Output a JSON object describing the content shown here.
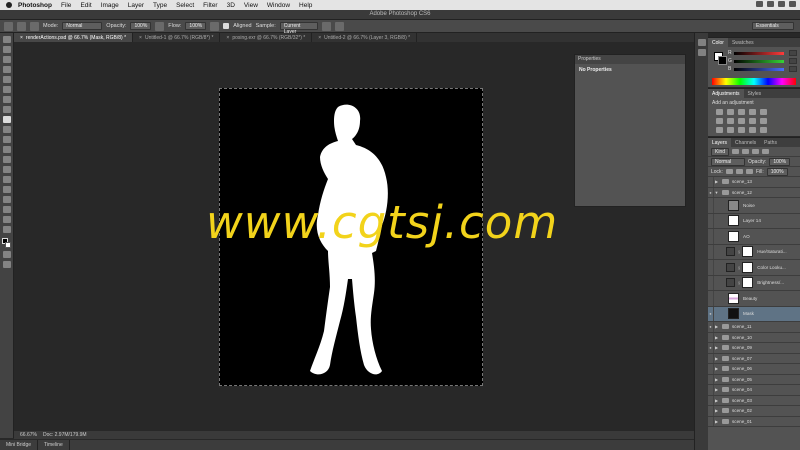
{
  "mac_menu": {
    "app": "Photoshop",
    "items": [
      "File",
      "Edit",
      "Image",
      "Layer",
      "Type",
      "Select",
      "Filter",
      "3D",
      "View",
      "Window",
      "Help"
    ]
  },
  "window_title": "Adobe Photoshop CS6",
  "options_bar": {
    "mode_label": "Mode:",
    "mode_value": "Normal",
    "opacity_label": "Opacity:",
    "opacity_value": "100%",
    "flow_label": "Flow:",
    "flow_value": "100%",
    "aligned_label": "Aligned",
    "sample_label": "Sample:",
    "sample_value": "Current Layer",
    "workspace": "Essentials"
  },
  "doc_tabs": [
    {
      "name": "renderActions.psd @ 66.7% (Mask, RGB/8) *"
    },
    {
      "name": "Untitled-1 @ 66.7% (RGB/8*) *"
    },
    {
      "name": "posing.exr @ 66.7% (RGB/32*) *"
    },
    {
      "name": "Untitled-2 @ 66.7% (Layer 3, RGB/8) *"
    }
  ],
  "watermark": "www.cgtsj.com",
  "properties_panel": {
    "title": "Properties",
    "content": "No Properties"
  },
  "status": {
    "zoom": "66.67%",
    "doc_info": "Doc: 2.97M/179.9M"
  },
  "bottom_tabs": [
    "Mini Bridge",
    "Timeline"
  ],
  "color_panel": {
    "tabs": [
      "Color",
      "Swatches"
    ],
    "channels": [
      {
        "label": "R",
        "color": "#ff3b3b"
      },
      {
        "label": "G",
        "color": "#35d435"
      },
      {
        "label": "B",
        "color": "#4a6bff"
      }
    ]
  },
  "adjustments_panel": {
    "tabs": [
      "Adjustments",
      "Styles"
    ],
    "note": "Add an adjustment"
  },
  "layers_panel": {
    "tabs": [
      "Layers",
      "Channels",
      "Paths"
    ],
    "kind": "Kind",
    "blend_mode": "Normal",
    "opacity_label": "Opacity:",
    "opacity_value": "100%",
    "lock_label": "Lock:",
    "fill_label": "Fill:",
    "fill_value": "100%",
    "layers": [
      {
        "name": "scene_13",
        "type": "folder",
        "open": false
      },
      {
        "name": "scene_12",
        "type": "folder",
        "open": true
      },
      {
        "name": "Noise",
        "type": "layer",
        "thumb": "gray"
      },
      {
        "name": "Layer 14",
        "type": "layer",
        "thumb": "white"
      },
      {
        "name": "AO",
        "type": "layer",
        "thumb": "white"
      },
      {
        "name": "Hue/Saturati...",
        "type": "adjust"
      },
      {
        "name": "Color Looku...",
        "type": "adjust"
      },
      {
        "name": "Brightness/...",
        "type": "adjust"
      },
      {
        "name": "Beauty",
        "type": "layer",
        "thumb": "pink"
      },
      {
        "name": "Mask",
        "type": "layer",
        "thumb": "mask",
        "selected": true
      },
      {
        "name": "scene_11",
        "type": "folder"
      },
      {
        "name": "scene_10",
        "type": "folder"
      },
      {
        "name": "scene_09",
        "type": "folder"
      },
      {
        "name": "scene_07",
        "type": "folder"
      },
      {
        "name": "scene_06",
        "type": "folder"
      },
      {
        "name": "scene_05",
        "type": "folder"
      },
      {
        "name": "scene_04",
        "type": "folder"
      },
      {
        "name": "scene_03",
        "type": "folder"
      },
      {
        "name": "scene_02",
        "type": "folder"
      },
      {
        "name": "scene_01",
        "type": "folder"
      }
    ]
  }
}
